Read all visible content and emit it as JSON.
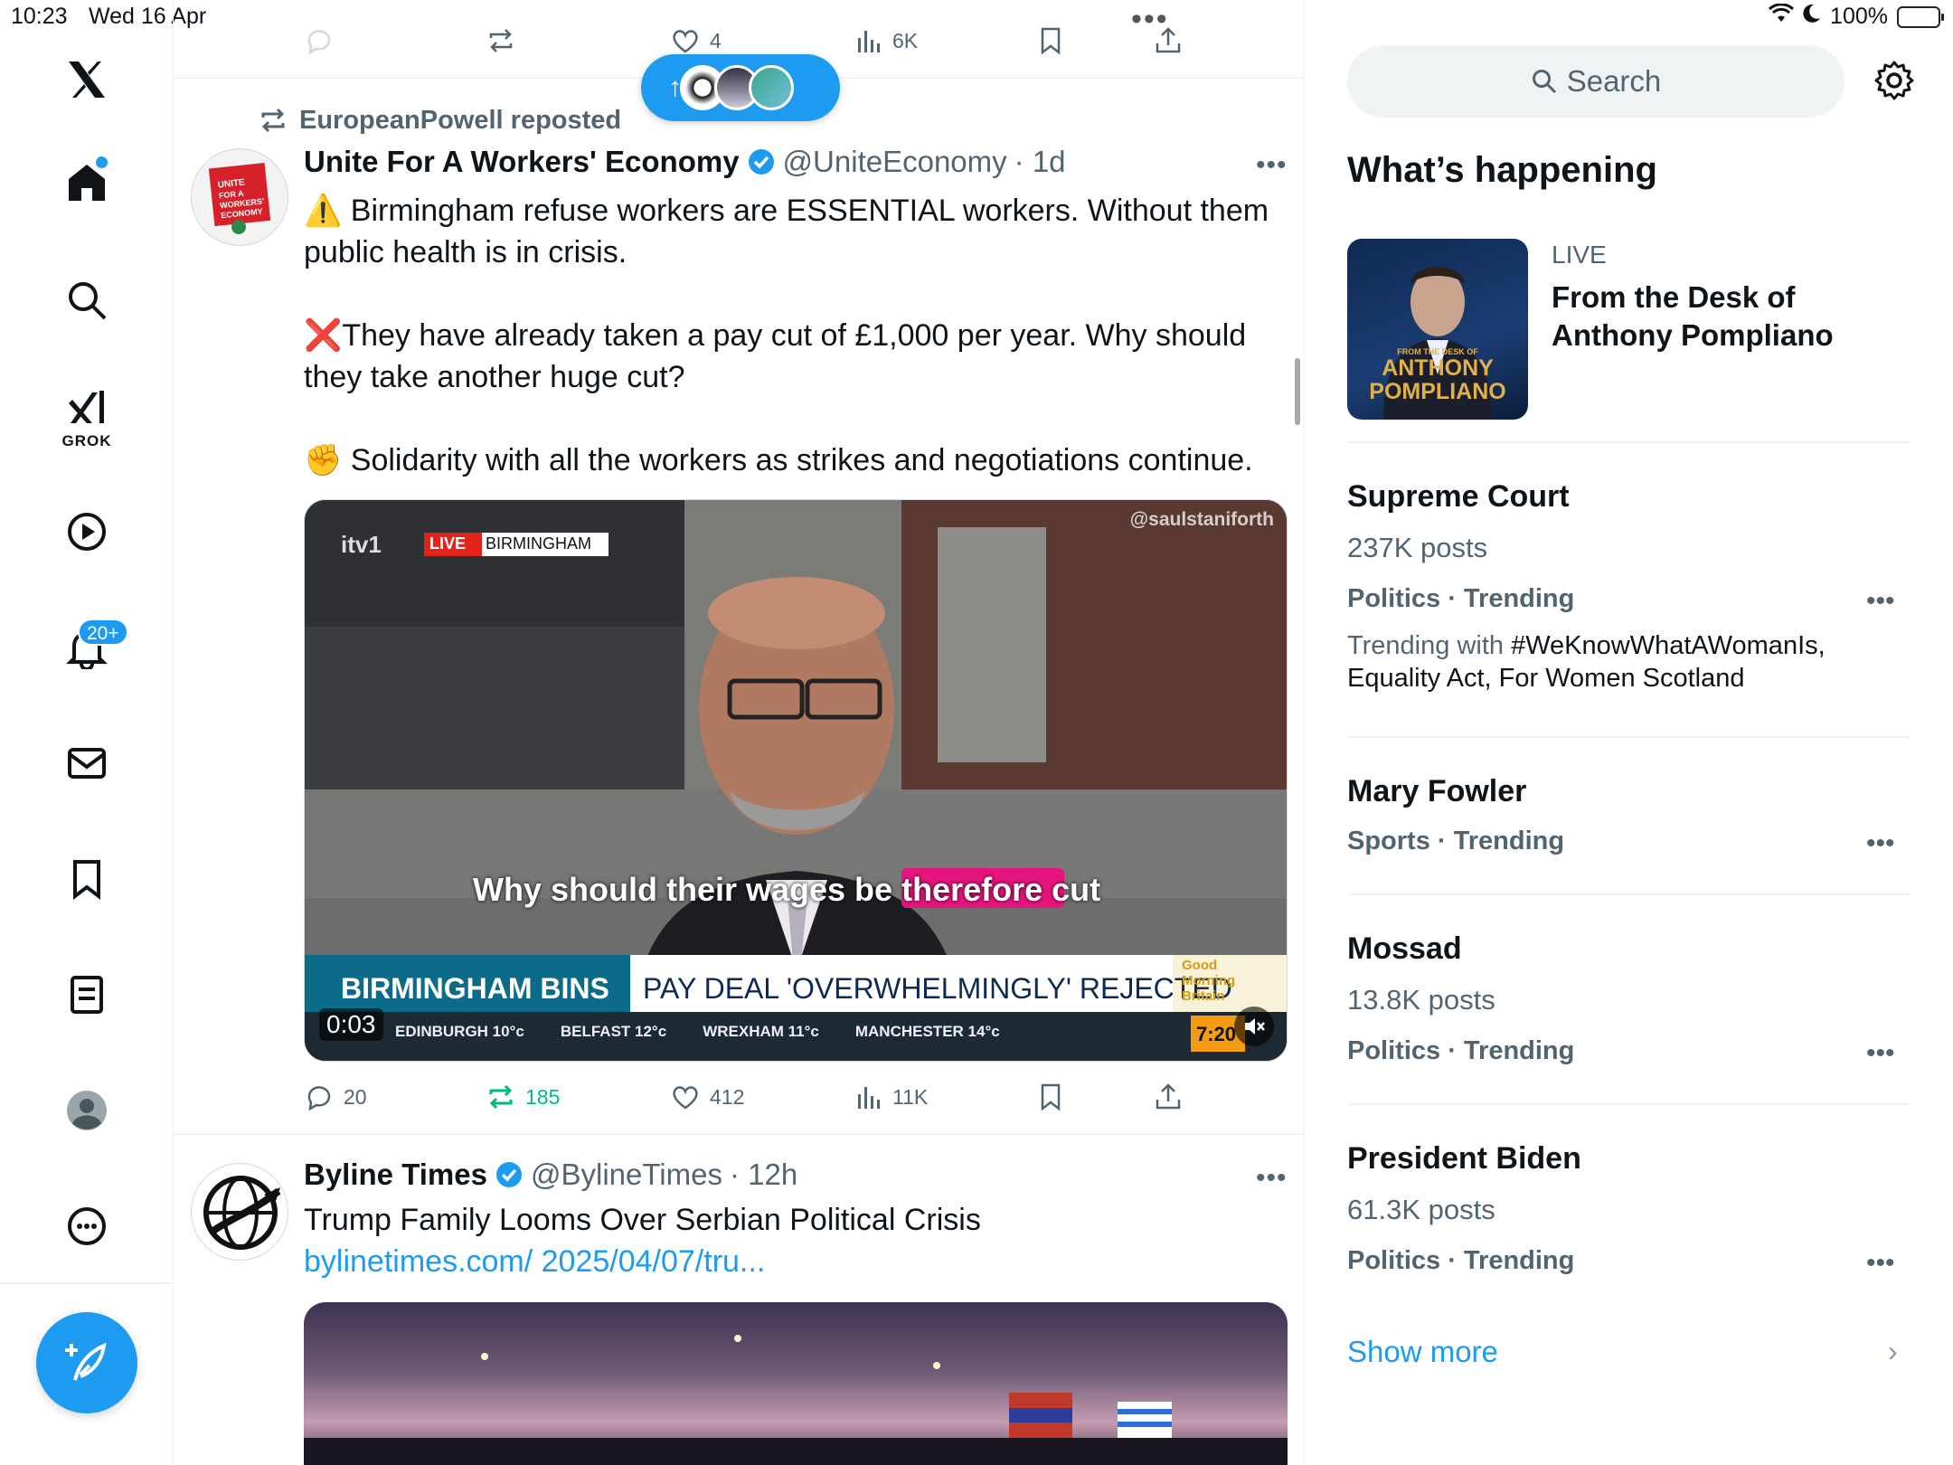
{
  "status_bar": {
    "time": "10:23",
    "date": "Wed 16 Apr",
    "battery": "100%"
  },
  "nav": {
    "grok_label": "GROK",
    "notifications_badge": "20+"
  },
  "prev_tweet_actions": {
    "replies": "",
    "reposts": "",
    "likes": "4",
    "views": "6K"
  },
  "tweet1": {
    "repost_by": "EuropeanPowell reposted",
    "name": "Unite For A Workers' Economy",
    "handle": "@UniteEconomy",
    "time": "· 1d",
    "avatar_text": "UNITE FOR A WORKERS' ECONOMY",
    "line1": "⚠️ Birmingham refuse workers are ESSENTIAL workers. Without them public health is in crisis.",
    "line2": "❌They have already taken a pay cut of £1,000 per year. Why should they take another huge cut?",
    "line3": "✊ Solidarity with all the workers as strikes and negotiations continue.",
    "video": {
      "channel": "itv1",
      "live_label": "LIVE",
      "location": "BIRMINGHAM",
      "watermark": "@saulstaniforth",
      "subtitle_a": "Why should their wages be ",
      "subtitle_b": "therefore cut",
      "ticker_left": "BIRMINGHAM BINS",
      "ticker_right": "PAY DEAL 'OVERWHELMINGLY' REJECTED",
      "show": "Good Morning Britain",
      "clock": "7:20",
      "duration": "0:03",
      "weather": [
        "EDINBURGH 10°c",
        "BELFAST 12°c",
        "WREXHAM 11°c",
        "MANCHESTER 14°c"
      ]
    },
    "replies": "20",
    "reposts": "185",
    "likes": "412",
    "views": "11K"
  },
  "tweet2": {
    "name": "Byline Times",
    "handle": "@BylineTimes",
    "time": "· 12h",
    "text": "Trump Family Looms Over Serbian Political Crisis ",
    "link": "bylinetimes.com/ 2025/04/07/tru..."
  },
  "sidebar": {
    "search_placeholder": "Search",
    "title": "What’s happening",
    "live": {
      "label": "LIVE",
      "title": "From the Desk of Anthony Pompliano",
      "thumb_small": "FROM THE DESK OF",
      "thumb_big1": "ANTHONY",
      "thumb_big2": "POMPLIANO"
    },
    "trends": [
      {
        "title": "Supreme Court",
        "posts": "237K posts",
        "category": "Politics · Trending",
        "with_prefix": "Trending with ",
        "with_terms": "#WeKnowWhatAWomanIs, Equality Act, For Women Scotland"
      },
      {
        "title": "Mary Fowler",
        "posts": "",
        "category": "Sports · Trending"
      },
      {
        "title": "Mossad",
        "posts": "13.8K posts",
        "category": "Politics · Trending"
      },
      {
        "title": "President Biden",
        "posts": "61.3K posts",
        "category": "Politics · Trending"
      }
    ],
    "show_more": "Show more"
  },
  "colors": {
    "accent": "#1d9bf0",
    "repost_green": "#00ba7c",
    "text_primary": "#0f1419",
    "text_secondary": "#536471"
  }
}
